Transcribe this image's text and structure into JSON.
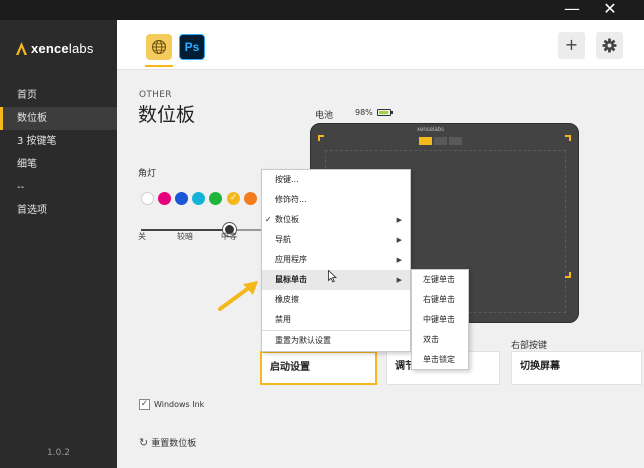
{
  "window": {
    "minimize_glyph": "—",
    "close_glyph": "✕"
  },
  "sidebar": {
    "logo": {
      "brand_bold": "xence",
      "brand_light": "labs"
    },
    "items": [
      {
        "label": "首页",
        "active": false
      },
      {
        "label": "数位板",
        "active": true
      },
      {
        "label": "3 按键笔",
        "active": false
      },
      {
        "label": "细笔",
        "active": false
      },
      {
        "label": "--",
        "active": false
      },
      {
        "label": "首选项",
        "active": false
      }
    ],
    "version": "1.0.2"
  },
  "header": {
    "apps": [
      {
        "name": "globe",
        "icon": "globe-icon",
        "selected": true
      },
      {
        "name": "Photoshop",
        "label": "Ps",
        "icon": "photoshop-icon",
        "selected": false
      }
    ],
    "add_glyph": "+",
    "settings_icon": "gear-icon"
  },
  "main": {
    "over_title": "OTHER",
    "title": "数位板",
    "battery_label": "电池",
    "battery_value": "98%",
    "light_label": "角灯",
    "colors": [
      "#ffffff",
      "#e6007e",
      "#1a56d6",
      "#12b3d8",
      "#20b53a",
      "#f5b81c",
      "#f57c1c"
    ],
    "selected_color": "#f5b81c",
    "brightness_ticks": [
      "关",
      "较暗",
      "中等"
    ],
    "brightness_level": "中等",
    "tablet_brand": "xencelabs",
    "keys": [
      {
        "caption": "",
        "label": "启动设置",
        "selected": true
      },
      {
        "caption": "",
        "label": "调节",
        "selected": false
      },
      {
        "caption": "右部按键",
        "label": "切换屏幕",
        "selected": false
      }
    ],
    "windows_ink_label": "Windows Ink",
    "windows_ink_checked": true,
    "reset_label": "重置数位板"
  },
  "context_menu": {
    "items": [
      {
        "label": "按键...",
        "checked": false,
        "submenu": false,
        "hover": false
      },
      {
        "label": "修饰符...",
        "checked": false,
        "submenu": false,
        "hover": false
      },
      {
        "label": "数位板",
        "checked": true,
        "submenu": true,
        "hover": false
      },
      {
        "label": "导航",
        "checked": false,
        "submenu": true,
        "hover": false
      },
      {
        "label": "应用程序",
        "checked": false,
        "submenu": true,
        "hover": false
      },
      {
        "label": "鼠标单击",
        "checked": false,
        "submenu": true,
        "hover": true
      },
      {
        "label": "橡皮擦",
        "checked": false,
        "submenu": false,
        "hover": false
      },
      {
        "label": "禁用",
        "checked": false,
        "submenu": false,
        "hover": false
      }
    ],
    "reset_item": "重置为默认设置",
    "submenu": [
      "左键单击",
      "右键单击",
      "中键单击",
      "双击",
      "单击锁定"
    ]
  }
}
